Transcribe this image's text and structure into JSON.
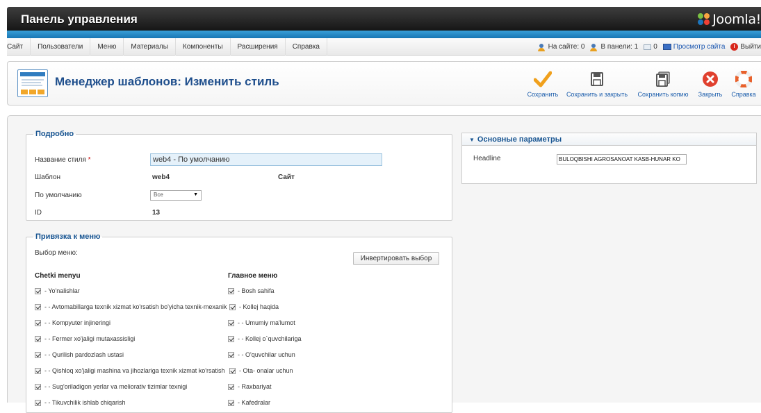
{
  "header": {
    "title": "Панель управления",
    "logo_text": "Joomla!"
  },
  "menubar": {
    "items": [
      "Сайт",
      "Пользователи",
      "Меню",
      "Материалы",
      "Компоненты",
      "Расширения",
      "Справка"
    ],
    "status": {
      "on_site": "На сайте: 0",
      "in_panel": "В панели: 1",
      "messages": "0",
      "view_site": "Просмотр сайта",
      "logout": "Выйти"
    }
  },
  "page": {
    "title": "Менеджер шаблонов: Изменить стиль",
    "toolbar": {
      "save": "Сохранить",
      "save_close": "Сохранить и закрыть",
      "save_copy": "Сохранить копию",
      "close": "Закрыть",
      "help": "Справка"
    }
  },
  "details": {
    "legend": "Подробно",
    "style_name_label": "Название стиля",
    "required_mark": "*",
    "style_name_value": "web4 - По умолчанию",
    "template_label": "Шаблон",
    "template_value": "web4",
    "client_value": "Сайт",
    "default_label": "По умолчанию",
    "default_value": "Все",
    "id_label": "ID",
    "id_value": "13"
  },
  "menu_assignment": {
    "legend": "Привязка к меню",
    "select_label": "Выбор меню:",
    "invert_button": "Инвертировать выбор",
    "col1_title": "Chetki menyu",
    "col1_items": [
      "- Yo'nalishlar",
      "- - Avtomabillarga texnik xizmat ko'rsatish bo'yicha texnik-mexanik",
      "- - Kompyuter injineringi",
      "- - Fermer xo'jaligi mutaxassisligi",
      "- - Qurilish pardozlash ustasi",
      "- - Qishloq xo'jaligi mashina va jihozlariga texnik xizmat ko'rsatish",
      "- - Sug'oriladigon yerlar va meliorativ tizimlar texnigi",
      "- - Tikuvchilik ishlab chiqarish"
    ],
    "col2_title": "Главное меню",
    "col2_items": [
      "- Bosh sahifa",
      "- Kollej haqida",
      "- - Umumiy ma'lumot",
      "- - Kollej o`quvchilariga",
      "- - O'quvchilar uchun",
      "- Ota- onalar uchun",
      "- Raxbariyat",
      "- Kafedralar"
    ]
  },
  "params": {
    "title": "Основные параметры",
    "headline_label": "Headline",
    "headline_value": "BULOQBISHI AGROSANOAT KASB-HUNAR KO"
  }
}
